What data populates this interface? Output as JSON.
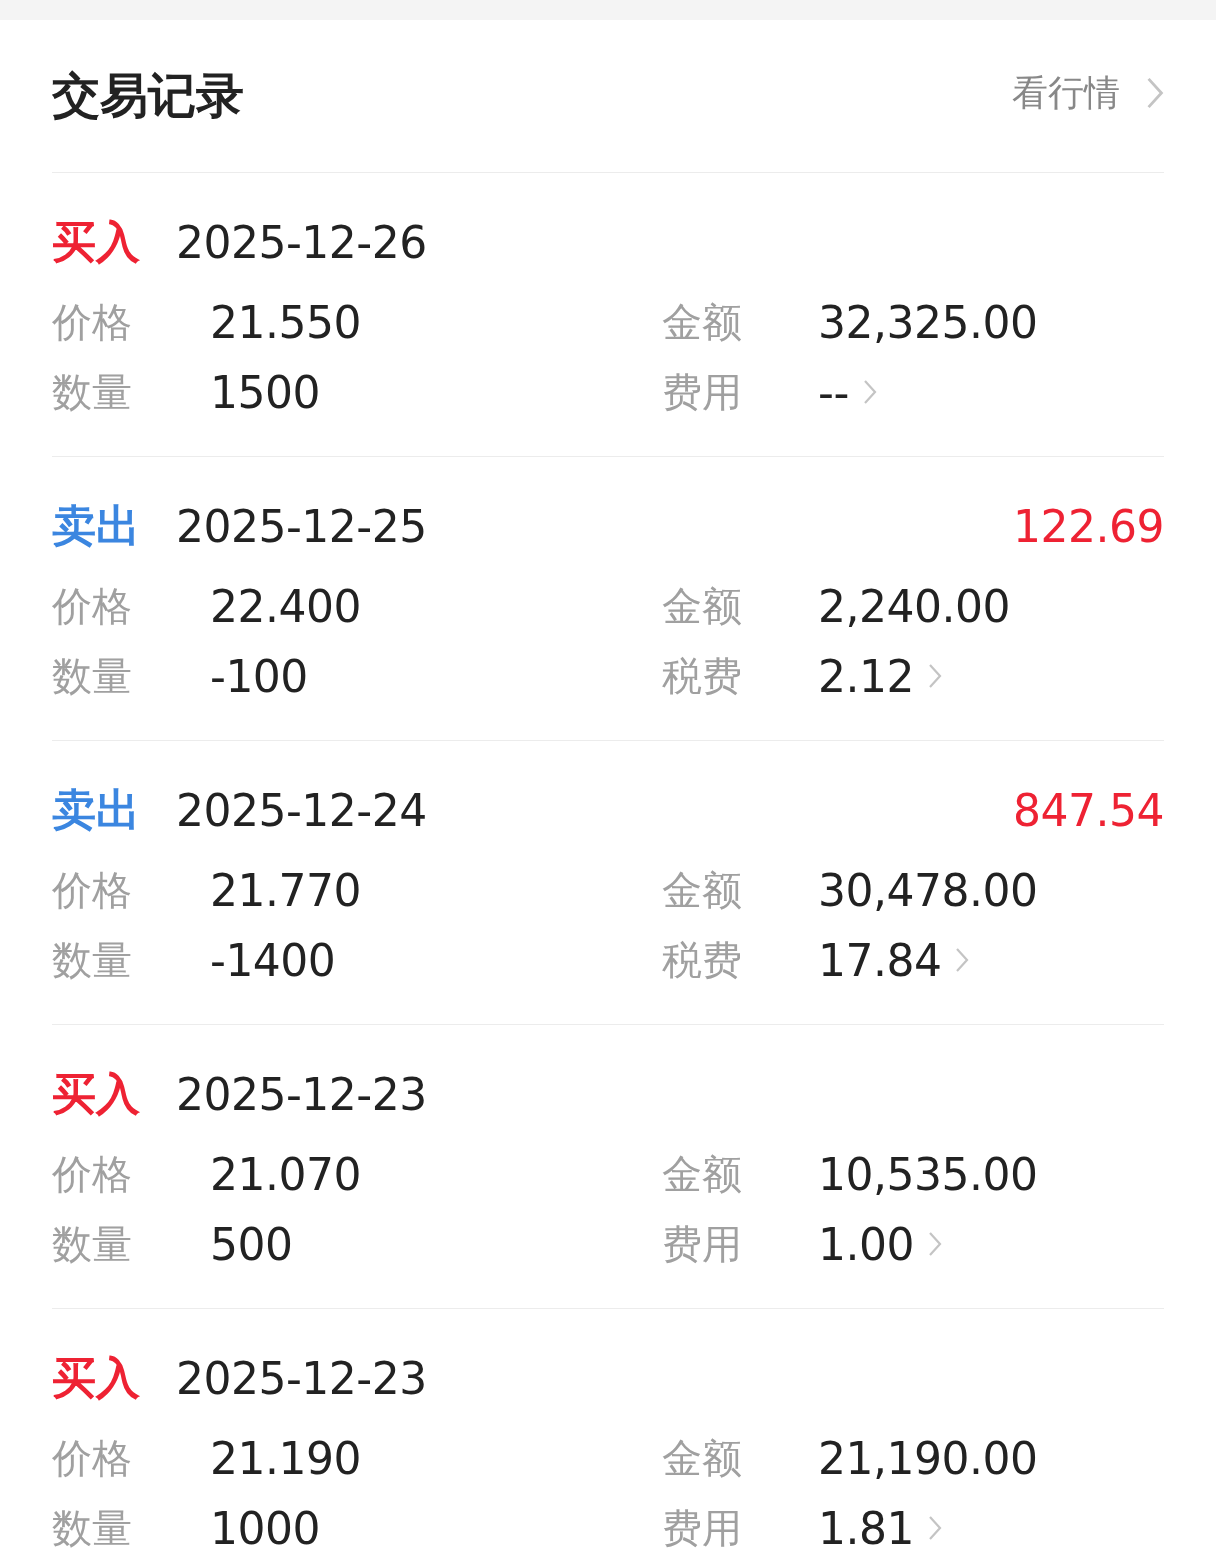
{
  "header": {
    "title": "交易记录",
    "link": "看行情"
  },
  "records": [
    {
      "kind": "buy",
      "type": "买入",
      "date": "2025-12-26",
      "price_label": "价格",
      "price": "21.550",
      "amount_label": "金额",
      "amount": "32,325.00",
      "qty_label": "数量",
      "qty": "1500",
      "fee_label": "费用",
      "fee": "--"
    },
    {
      "kind": "sell",
      "type": "卖出",
      "date": "2025-12-25",
      "profit": "122.69",
      "price_label": "价格",
      "price": "22.400",
      "amount_label": "金额",
      "amount": "2,240.00",
      "qty_label": "数量",
      "qty": "-100",
      "fee_label": "税费",
      "fee": "2.12"
    },
    {
      "kind": "sell",
      "type": "卖出",
      "date": "2025-12-24",
      "profit": "847.54",
      "price_label": "价格",
      "price": "21.770",
      "amount_label": "金额",
      "amount": "30,478.00",
      "qty_label": "数量",
      "qty": "-1400",
      "fee_label": "税费",
      "fee": "17.84"
    },
    {
      "kind": "buy",
      "type": "买入",
      "date": "2025-12-23",
      "price_label": "价格",
      "price": "21.070",
      "amount_label": "金额",
      "amount": "10,535.00",
      "qty_label": "数量",
      "qty": "500",
      "fee_label": "费用",
      "fee": "1.00"
    },
    {
      "kind": "buy",
      "type": "买入",
      "date": "2025-12-23",
      "price_label": "价格",
      "price": "21.190",
      "amount_label": "金额",
      "amount": "21,190.00",
      "qty_label": "数量",
      "qty": "1000",
      "fee_label": "费用",
      "fee": "1.81"
    }
  ]
}
